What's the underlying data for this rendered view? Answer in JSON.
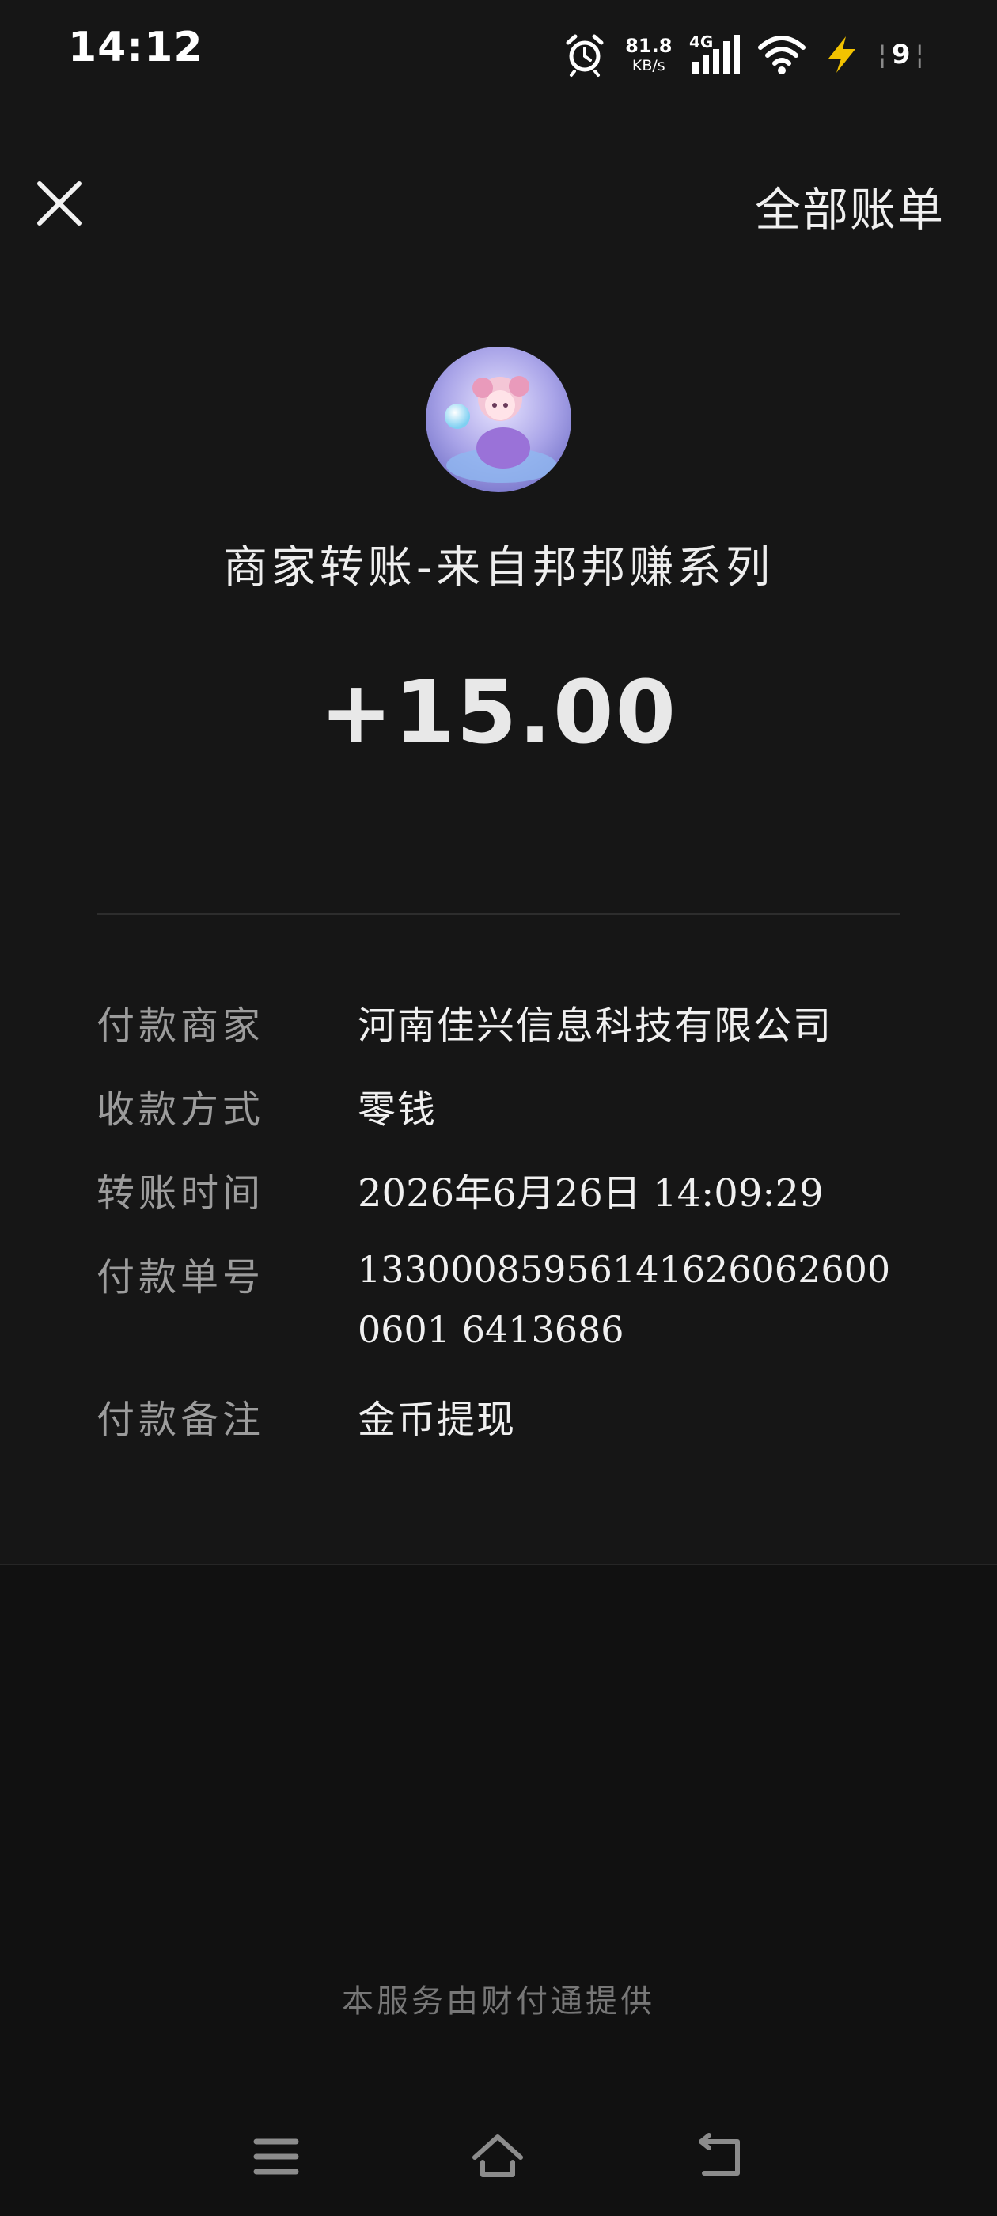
{
  "status_bar": {
    "time": "14:12",
    "net_speed_value": "81.8",
    "net_speed_unit": "KB/s",
    "network_type": "4G",
    "battery": "9",
    "icons": [
      "alarm-icon",
      "signal-icon",
      "wifi-icon",
      "charging-icon",
      "battery-icon"
    ]
  },
  "header": {
    "close_icon": "close-icon",
    "all_bills_label": "全部账单"
  },
  "transfer": {
    "title": "商家转账-来自邦邦赚系列",
    "amount": "+15.00"
  },
  "details": [
    {
      "label": "付款商家",
      "value": "河南佳兴信息科技有限公司"
    },
    {
      "label": "收款方式",
      "value": "零钱"
    },
    {
      "label": "转账时间",
      "value": "2026年6月26日 14:09:29"
    },
    {
      "label": "付款单号",
      "value": "133000859561416260626000601 6413686"
    },
    {
      "label": "付款备注",
      "value": "金币提现"
    }
  ],
  "footer": {
    "provider_text": "本服务由财付通提供"
  },
  "nav_bar": {
    "icons": [
      "menu-icon",
      "home-icon",
      "back-icon"
    ]
  },
  "colors": {
    "background": "#111111",
    "panel": "#161616",
    "label": "#9c9c9c",
    "value": "#f0f0f0",
    "charging": "#f2c200"
  }
}
